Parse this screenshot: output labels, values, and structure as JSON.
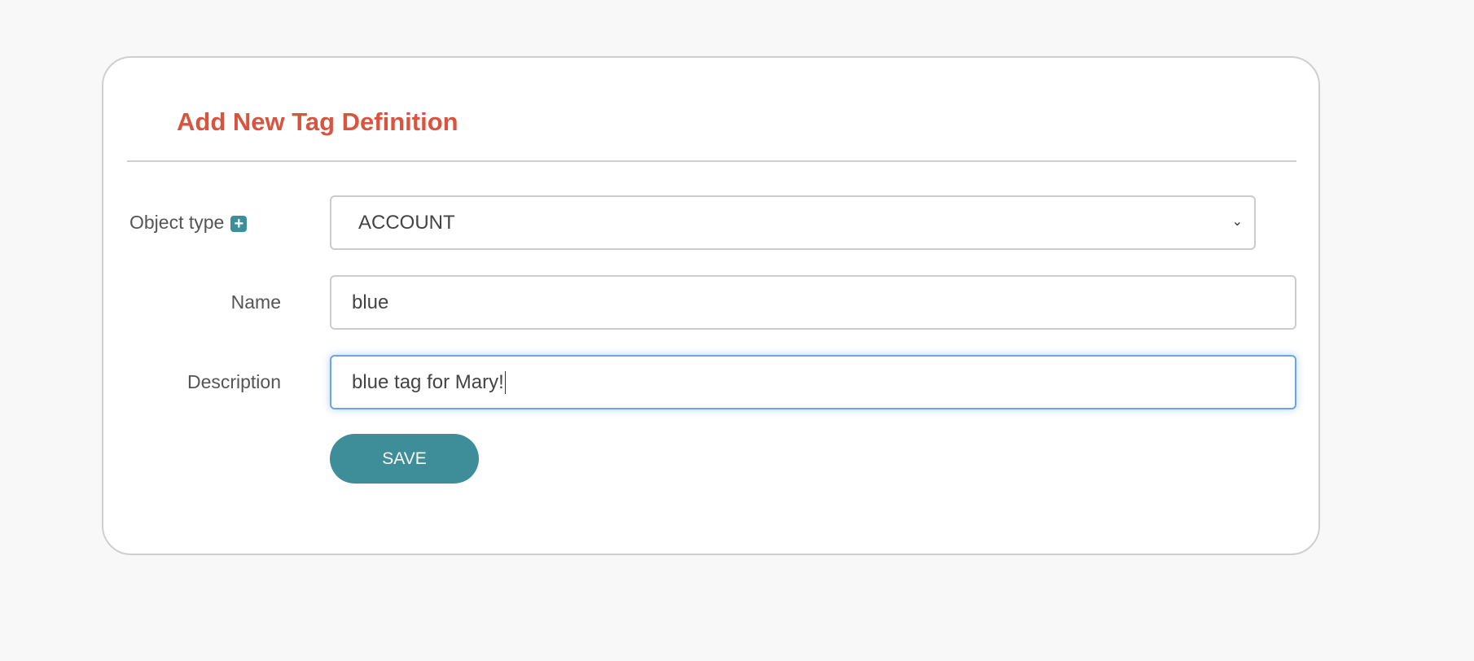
{
  "form": {
    "title": "Add New Tag Definition",
    "object_type_label": "Object type",
    "object_type_value": "ACCOUNT",
    "name_label": "Name",
    "name_value": "blue",
    "description_label": "Description",
    "description_value": "blue tag for Mary!",
    "save_label": "SAVE"
  },
  "colors": {
    "accent": "#3e8e9a",
    "title": "#d9543f",
    "focus": "#6aa6e0"
  },
  "icons": {
    "add": "plus-square-icon",
    "dropdown": "chevron-down-icon"
  }
}
